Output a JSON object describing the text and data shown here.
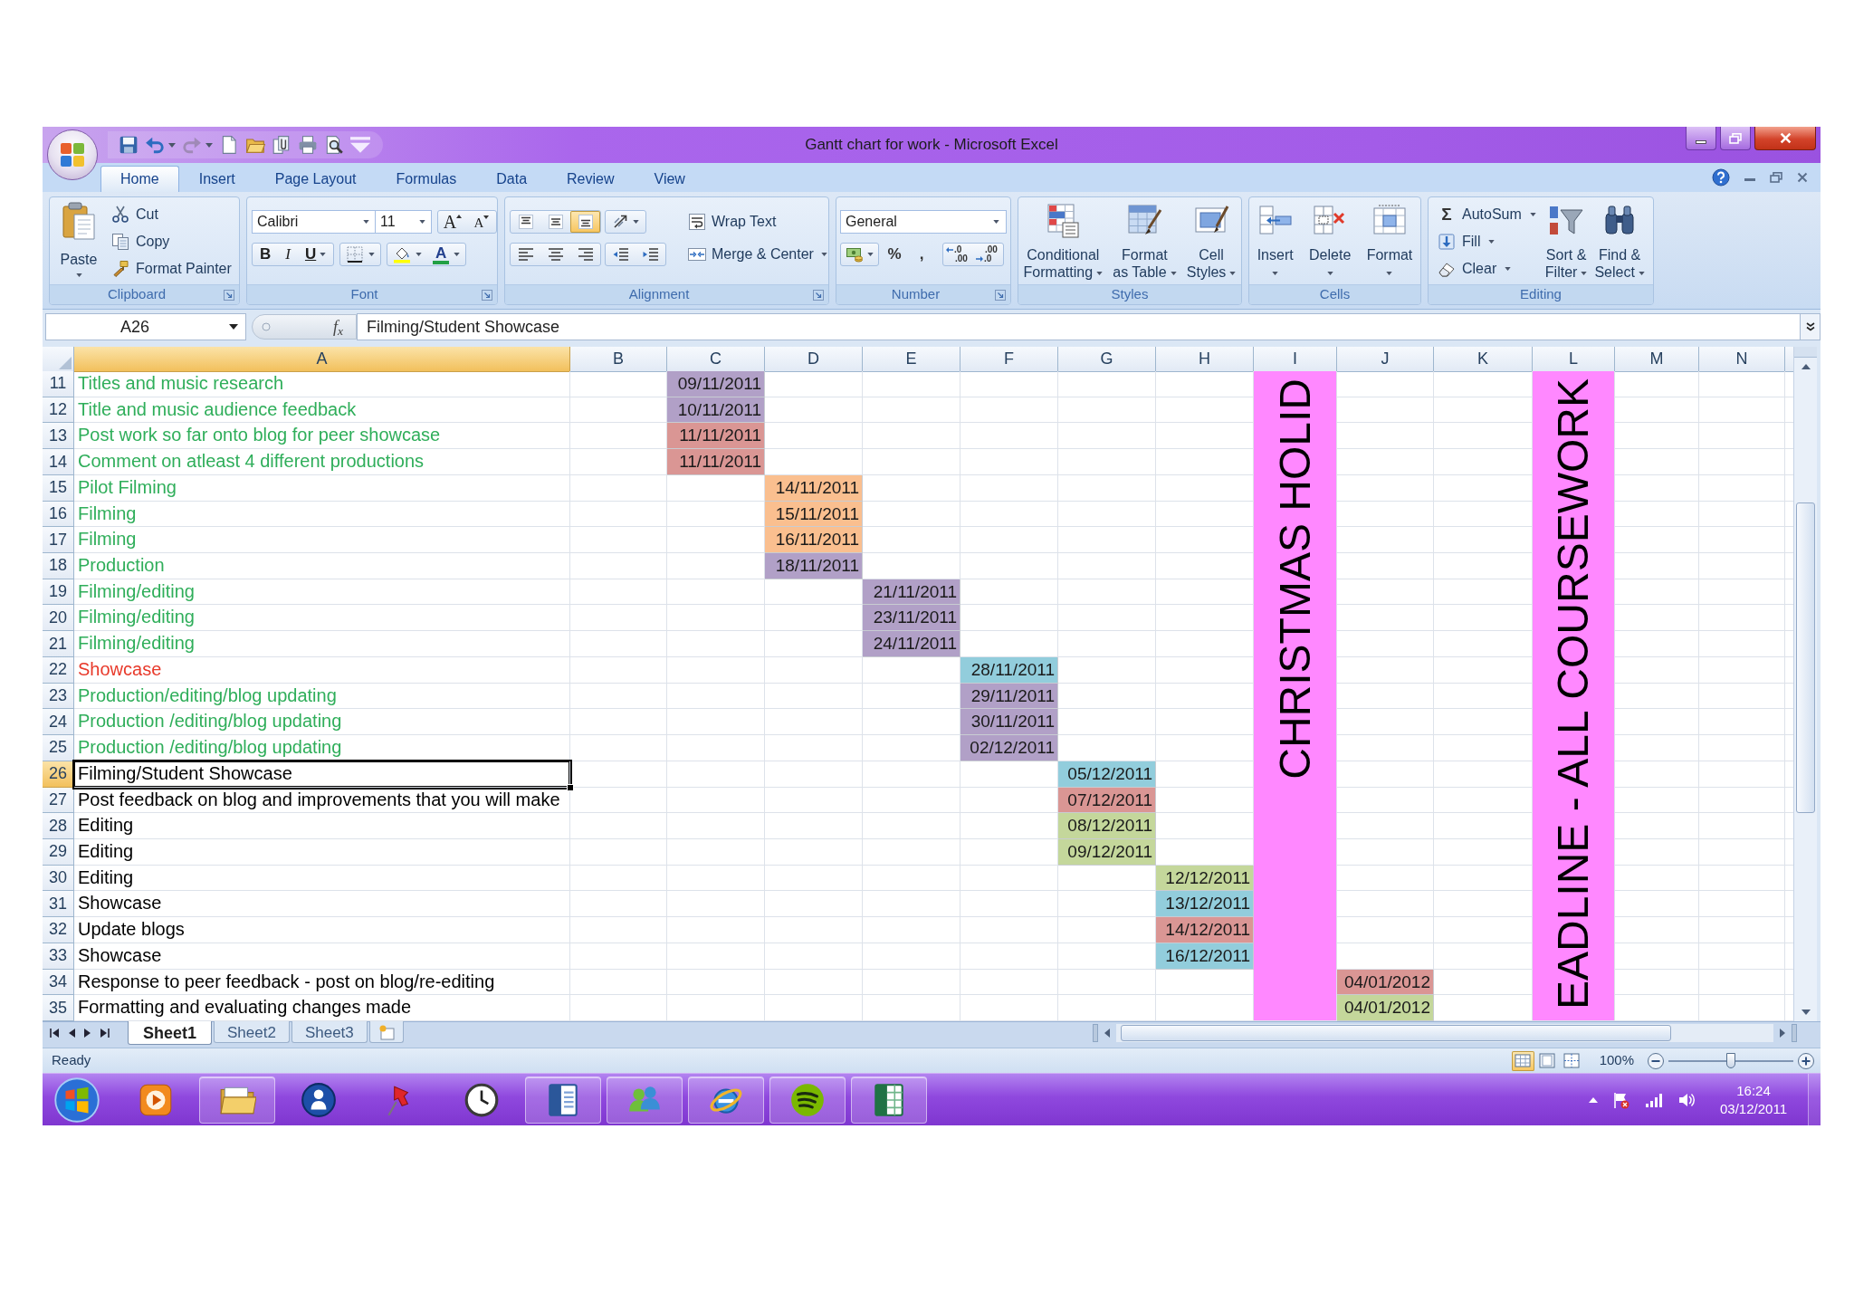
{
  "window": {
    "title": "Gantt chart for work - Microsoft Excel"
  },
  "quick_access": [
    {
      "kind": "save",
      "disabled": false
    },
    {
      "kind": "undo",
      "disabled": false,
      "menu": true
    },
    {
      "kind": "redo",
      "disabled": true,
      "menu": true
    },
    {
      "kind": "new",
      "disabled": false
    },
    {
      "kind": "open",
      "disabled": false
    },
    {
      "kind": "attach",
      "disabled": false
    },
    {
      "kind": "print",
      "disabled": false
    },
    {
      "kind": "preview",
      "disabled": false
    },
    {
      "kind": "customize",
      "disabled": false
    }
  ],
  "ribbon_tabs": [
    {
      "label": "Home",
      "selected": true
    },
    {
      "label": "Insert",
      "selected": false
    },
    {
      "label": "Page Layout",
      "selected": false
    },
    {
      "label": "Formulas",
      "selected": false
    },
    {
      "label": "Data",
      "selected": false
    },
    {
      "label": "Review",
      "selected": false
    },
    {
      "label": "View",
      "selected": false
    }
  ],
  "ribbon_groups": [
    {
      "kind": "clipboard",
      "label": "Clipboard",
      "launcher": true,
      "buttons": [
        {
          "kind": "paste",
          "label": "Paste",
          "menu": true
        },
        {
          "kind": "cut",
          "label": "Cut"
        },
        {
          "kind": "copy",
          "label": "Copy"
        },
        {
          "kind": "painter",
          "label": "Format Painter"
        }
      ]
    },
    {
      "kind": "font",
      "label": "Font",
      "launcher": true,
      "font_name": "Calibri",
      "font_size": "11",
      "buttons": [
        {
          "kind": "grow",
          "label": "A"
        },
        {
          "kind": "shrink",
          "label": "A"
        },
        {
          "kind": "bold",
          "label": "B"
        },
        {
          "kind": "italic",
          "label": "I"
        },
        {
          "kind": "underline",
          "label": "U",
          "menu": true
        },
        {
          "kind": "borders",
          "menu": true
        },
        {
          "kind": "fill",
          "menu": true
        },
        {
          "kind": "font_color",
          "label": "A",
          "menu": true
        }
      ]
    },
    {
      "kind": "alignment",
      "label": "Alignment",
      "launcher": true,
      "buttons": [
        {
          "kind": "align_top",
          "selected": false
        },
        {
          "kind": "align_middle",
          "selected": false
        },
        {
          "kind": "align_bottom",
          "selected": true
        },
        {
          "kind": "orientation",
          "selected": false,
          "menu": true
        },
        {
          "kind": "align_left",
          "selected": false
        },
        {
          "kind": "align_center",
          "selected": false
        },
        {
          "kind": "align_right",
          "selected": false
        },
        {
          "kind": "decrease_indent",
          "selected": false
        },
        {
          "kind": "increase_indent",
          "selected": false
        },
        {
          "kind": "wrap",
          "label": "Wrap Text",
          "selected": false
        },
        {
          "kind": "merge",
          "label": "Merge & Center",
          "selected": false,
          "menu": true
        }
      ]
    },
    {
      "kind": "number",
      "label": "Number",
      "launcher": true,
      "format": "General",
      "buttons": [
        {
          "kind": "accounting",
          "menu": true
        },
        {
          "kind": "percent",
          "label": "%"
        },
        {
          "kind": "comma",
          "label": ","
        },
        {
          "kind": "increase_decimal",
          "lines": [
            ".0",
            ".00"
          ]
        },
        {
          "kind": "decrease_decimal",
          "lines": [
            ".00",
            ".0"
          ]
        }
      ]
    },
    {
      "kind": "styles",
      "label": "Styles",
      "buttons": [
        {
          "kind": "conditional",
          "label": "Conditional\nFormatting",
          "menu": true
        },
        {
          "kind": "table",
          "label": "Format\nas Table",
          "menu": true
        },
        {
          "kind": "cell_styles",
          "label": "Cell\nStyles",
          "menu": true
        }
      ]
    },
    {
      "kind": "cells",
      "label": "Cells",
      "buttons": [
        {
          "kind": "insert",
          "label": "Insert",
          "menu": true
        },
        {
          "kind": "delete",
          "label": "Delete",
          "menu": true
        },
        {
          "kind": "format",
          "label": "Format",
          "menu": true
        }
      ]
    },
    {
      "kind": "editing",
      "label": "Editing",
      "buttons": [
        {
          "kind": "autosum",
          "glyph": "Σ",
          "label": "AutoSum",
          "menu": true
        },
        {
          "kind": "fill_down",
          "label": "Fill",
          "menu": true
        },
        {
          "kind": "clear",
          "label": "Clear",
          "menu": true
        },
        {
          "kind": "sort",
          "label": "Sort &\nFilter",
          "menu": true
        },
        {
          "kind": "find",
          "label": "Find &\nSelect",
          "menu": true
        }
      ]
    }
  ],
  "formula_bar": {
    "name_box": "A26",
    "function_label": "f$_{x}$",
    "formula": "Filming/Student Showcase"
  },
  "sheet": {
    "columns": [
      {
        "label": "A",
        "selected": true
      },
      {
        "label": "B",
        "selected": false
      },
      {
        "label": "C",
        "selected": false
      },
      {
        "label": "D",
        "selected": false
      },
      {
        "label": "E",
        "selected": false
      },
      {
        "label": "F",
        "selected": false
      },
      {
        "label": "G",
        "selected": false
      },
      {
        "label": "H",
        "selected": false
      },
      {
        "label": "I",
        "selected": false,
        "band": {
          "text": "CHRISTMAS HOLID",
          "color": "#ff88ff"
        }
      },
      {
        "label": "J",
        "selected": false
      },
      {
        "label": "K",
        "selected": false
      },
      {
        "label": "L",
        "selected": false,
        "band": {
          "text": "EADLINE - ALL COURSEWORK",
          "color": "#ff88ff"
        }
      },
      {
        "label": "M",
        "selected": false
      },
      {
        "label": "N",
        "selected": false
      }
    ],
    "rows": [
      {
        "number": "11",
        "selected": false,
        "cells": [
          {
            "kind": "text",
            "text": "Titles and music research",
            "color": "#2fae5a"
          },
          null,
          {
            "kind": "date",
            "text": "09/11/2011",
            "color": "#b1a0c7"
          }
        ]
      },
      {
        "number": "12",
        "selected": false,
        "cells": [
          {
            "kind": "text",
            "text": "Title and music audience feedback",
            "color": "#2fae5a"
          },
          null,
          {
            "kind": "date",
            "text": "10/11/2011",
            "color": "#b1a0c7"
          }
        ]
      },
      {
        "number": "13",
        "selected": false,
        "cells": [
          {
            "kind": "text",
            "text": "Post work so far onto blog for peer showcase",
            "color": "#2fae5a"
          },
          null,
          {
            "kind": "date",
            "text": "11/11/2011",
            "color": "#da9694"
          }
        ]
      },
      {
        "number": "14",
        "selected": false,
        "cells": [
          {
            "kind": "text",
            "text": "Comment on atleast 4 different productions",
            "color": "#2fae5a"
          },
          null,
          {
            "kind": "date",
            "text": "11/11/2011",
            "color": "#da9694"
          }
        ]
      },
      {
        "number": "15",
        "selected": false,
        "cells": [
          {
            "kind": "text",
            "text": "Pilot Filming",
            "color": "#2fae5a"
          },
          null,
          null,
          {
            "kind": "date",
            "text": "14/11/2011",
            "color": "#fabf8f"
          }
        ]
      },
      {
        "number": "16",
        "selected": false,
        "cells": [
          {
            "kind": "text",
            "text": "Filming",
            "color": "#2fae5a"
          },
          null,
          null,
          {
            "kind": "date",
            "text": "15/11/2011",
            "color": "#fabf8f"
          }
        ]
      },
      {
        "number": "17",
        "selected": false,
        "cells": [
          {
            "kind": "text",
            "text": "Filming",
            "color": "#2fae5a"
          },
          null,
          null,
          {
            "kind": "date",
            "text": "16/11/2011",
            "color": "#fabf8f"
          }
        ]
      },
      {
        "number": "18",
        "selected": false,
        "cells": [
          {
            "kind": "text",
            "text": "Production",
            "color": "#2fae5a"
          },
          null,
          null,
          {
            "kind": "date",
            "text": "18/11/2011",
            "color": "#b1a0c7"
          }
        ]
      },
      {
        "number": "19",
        "selected": false,
        "cells": [
          {
            "kind": "text",
            "text": "Filming/editing",
            "color": "#2fae5a"
          },
          null,
          null,
          null,
          {
            "kind": "date",
            "text": "21/11/2011",
            "color": "#b1a0c7"
          }
        ]
      },
      {
        "number": "20",
        "selected": false,
        "cells": [
          {
            "kind": "text",
            "text": "Filming/editing",
            "color": "#2fae5a"
          },
          null,
          null,
          null,
          {
            "kind": "date",
            "text": "23/11/2011",
            "color": "#b1a0c7"
          }
        ]
      },
      {
        "number": "21",
        "selected": false,
        "cells": [
          {
            "kind": "text",
            "text": "Filming/editing",
            "color": "#2fae5a"
          },
          null,
          null,
          null,
          {
            "kind": "date",
            "text": "24/11/2011",
            "color": "#b1a0c7"
          }
        ]
      },
      {
        "number": "22",
        "selected": false,
        "cells": [
          {
            "kind": "text",
            "text": "Showcase",
            "color": "#e8392a"
          },
          null,
          null,
          null,
          null,
          {
            "kind": "date",
            "text": "28/11/2011",
            "color": "#92cddc"
          }
        ]
      },
      {
        "number": "23",
        "selected": false,
        "cells": [
          {
            "kind": "text",
            "text": "Production/editing/blog updating",
            "color": "#2fae5a"
          },
          null,
          null,
          null,
          null,
          {
            "kind": "date",
            "text": "29/11/2011",
            "color": "#b1a0c7"
          }
        ]
      },
      {
        "number": "24",
        "selected": false,
        "cells": [
          {
            "kind": "text",
            "text": "Production /editing/blog updating",
            "color": "#2fae5a"
          },
          null,
          null,
          null,
          null,
          {
            "kind": "date",
            "text": "30/11/2011",
            "color": "#b1a0c7"
          }
        ]
      },
      {
        "number": "25",
        "selected": false,
        "cells": [
          {
            "kind": "text",
            "text": "Production /editing/blog updating",
            "color": "#2fae5a"
          },
          null,
          null,
          null,
          null,
          {
            "kind": "date",
            "text": "02/12/2011",
            "color": "#b1a0c7"
          }
        ]
      },
      {
        "number": "26",
        "selected": true,
        "cells": [
          {
            "kind": "text",
            "text": "Filming/Student Showcase",
            "color": "#000000"
          },
          null,
          null,
          null,
          null,
          null,
          {
            "kind": "date",
            "text": "05/12/2011",
            "color": "#92cddc"
          }
        ]
      },
      {
        "number": "27",
        "selected": false,
        "cells": [
          {
            "kind": "text",
            "text": "Post feedback on blog and improvements that you will make",
            "color": "#000000"
          },
          null,
          null,
          null,
          null,
          null,
          {
            "kind": "date",
            "text": "07/12/2011",
            "color": "#da9694"
          }
        ]
      },
      {
        "number": "28",
        "selected": false,
        "cells": [
          {
            "kind": "text",
            "text": "Editing",
            "color": "#000000"
          },
          null,
          null,
          null,
          null,
          null,
          {
            "kind": "date",
            "text": "08/12/2011",
            "color": "#c4d79b"
          }
        ]
      },
      {
        "number": "29",
        "selected": false,
        "cells": [
          {
            "kind": "text",
            "text": "Editing",
            "color": "#000000"
          },
          null,
          null,
          null,
          null,
          null,
          {
            "kind": "date",
            "text": "09/12/2011",
            "color": "#c4d79b"
          }
        ]
      },
      {
        "number": "30",
        "selected": false,
        "cells": [
          {
            "kind": "text",
            "text": "Editing",
            "color": "#000000"
          },
          null,
          null,
          null,
          null,
          null,
          null,
          {
            "kind": "date",
            "text": "12/12/2011",
            "color": "#c4d79b"
          }
        ]
      },
      {
        "number": "31",
        "selected": false,
        "cells": [
          {
            "kind": "text",
            "text": "Showcase",
            "color": "#000000"
          },
          null,
          null,
          null,
          null,
          null,
          null,
          {
            "kind": "date",
            "text": "13/12/2011",
            "color": "#92cddc"
          }
        ]
      },
      {
        "number": "32",
        "selected": false,
        "cells": [
          {
            "kind": "text",
            "text": "Update blogs",
            "color": "#000000"
          },
          null,
          null,
          null,
          null,
          null,
          null,
          {
            "kind": "date",
            "text": "14/12/2011",
            "color": "#da9694"
          }
        ]
      },
      {
        "number": "33",
        "selected": false,
        "cells": [
          {
            "kind": "text",
            "text": "Showcase",
            "color": "#000000"
          },
          null,
          null,
          null,
          null,
          null,
          null,
          {
            "kind": "date",
            "text": "16/12/2011",
            "color": "#92cddc"
          }
        ]
      },
      {
        "number": "34",
        "selected": false,
        "cells": [
          {
            "kind": "text",
            "text": "Response to peer feedback - post on blog/re-editing",
            "color": "#000000"
          },
          null,
          null,
          null,
          null,
          null,
          null,
          null,
          null,
          {
            "kind": "date",
            "text": "04/01/2012",
            "color": "#da9694"
          }
        ]
      },
      {
        "number": "35",
        "selected": false,
        "cells": [
          {
            "kind": "text",
            "text": "Formatting and evaluating changes made",
            "color": "#000000"
          },
          null,
          null,
          null,
          null,
          null,
          null,
          null,
          null,
          {
            "kind": "date",
            "text": "04/01/2012",
            "color": "#c4d79b"
          }
        ]
      }
    ]
  },
  "sheet_tabs": [
    {
      "label": "Sheet1",
      "selected": true
    },
    {
      "label": "Sheet2",
      "selected": false
    },
    {
      "label": "Sheet3",
      "selected": false
    }
  ],
  "status_bar": {
    "status": "Ready",
    "views": [
      {
        "kind": "normal",
        "selected": true
      },
      {
        "kind": "page_layout",
        "selected": false
      },
      {
        "kind": "page_break",
        "selected": false
      }
    ],
    "zoom": "100%",
    "zoom_slider": {
      "level": 0.5
    }
  },
  "taskbar": {
    "apps": [
      {
        "kind": "player",
        "running": false
      },
      {
        "kind": "folder",
        "running": true
      },
      {
        "kind": "person",
        "running": false
      },
      {
        "kind": "pin",
        "running": false
      },
      {
        "kind": "clock",
        "running": false
      },
      {
        "kind": "document",
        "running": true
      },
      {
        "kind": "people",
        "running": true
      },
      {
        "kind": "browser",
        "running": true
      },
      {
        "kind": "music",
        "running": true
      },
      {
        "kind": "spreadsheet",
        "running": true
      }
    ],
    "time": "16:24",
    "date": "03/12/2011"
  }
}
